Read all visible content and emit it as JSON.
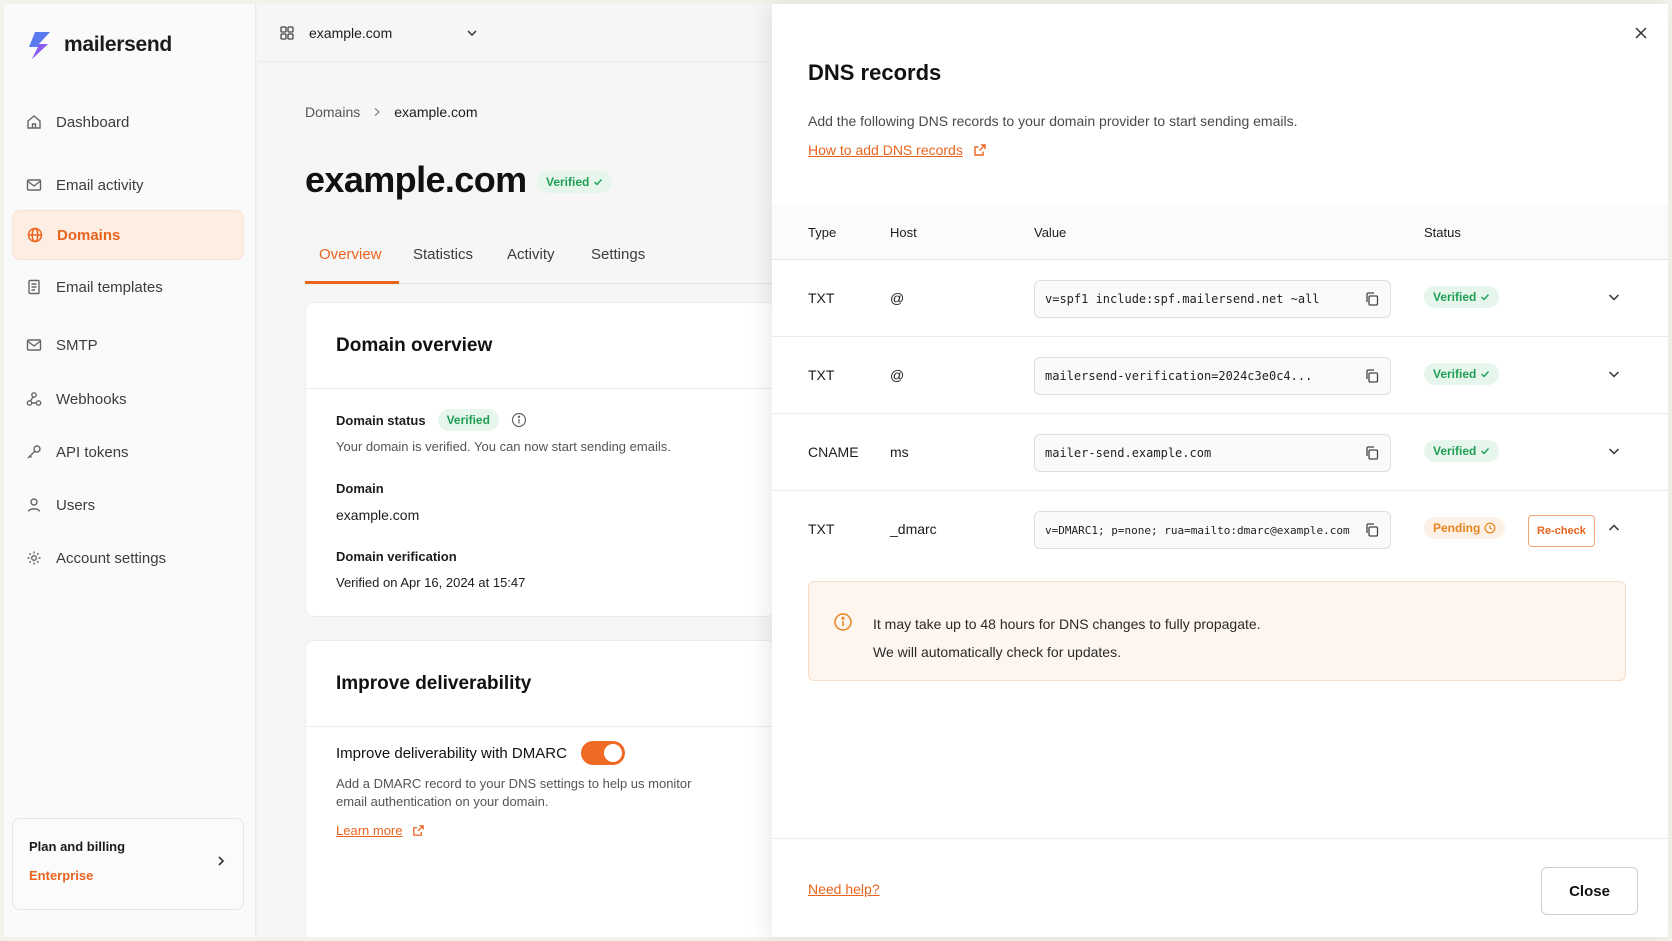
{
  "app": {
    "brand": "mailersend"
  },
  "sidebar": {
    "items": [
      {
        "label": "Dashboard",
        "icon": "home-icon"
      },
      {
        "label": "Email activity",
        "icon": "mail-icon"
      },
      {
        "label": "Domains",
        "icon": "globe-icon",
        "active": true
      },
      {
        "label": "Email templates",
        "icon": "document-icon"
      },
      {
        "label": "SMTP",
        "icon": "mail-icon"
      },
      {
        "label": "Webhooks",
        "icon": "webhook-icon"
      },
      {
        "label": "API tokens",
        "icon": "key-icon"
      },
      {
        "label": "Users",
        "icon": "user-icon"
      },
      {
        "label": "Account settings",
        "icon": "gear-icon"
      }
    ],
    "billing": {
      "title": "Plan and billing",
      "plan": "Enterprise"
    }
  },
  "topbar": {
    "domain_selector": "example.com"
  },
  "breadcrumb": {
    "parent": "Domains",
    "current": "example.com"
  },
  "page": {
    "title": "example.com",
    "status": "Verified"
  },
  "tabs": [
    "Overview",
    "Statistics",
    "Activity",
    "Settings"
  ],
  "overview": {
    "title": "Domain overview",
    "status_label": "Domain status",
    "status_value": "Verified",
    "status_text": "Your domain is verified. You can now start sending emails.",
    "domain_label": "Domain",
    "domain_value": "example.com",
    "verification_label": "Domain verification",
    "verification_value": "Verified on Apr 16, 2024 at 15:47"
  },
  "deliverability": {
    "title": "Improve deliverability",
    "dmarc_label": "Improve deliverability with DMARC",
    "dmarc_enabled": true,
    "description_line1": "Add a DMARC record to your DNS settings to help us monitor",
    "description_line2": "email authentication on your domain.",
    "learn_more": "Learn more"
  },
  "drawer": {
    "title": "DNS records",
    "description": "Add the following DNS records to your domain provider to start sending emails.",
    "howto_link": "How to add DNS records",
    "columns": {
      "type": "Type",
      "host": "Host",
      "value": "Value",
      "status": "Status"
    },
    "records": [
      {
        "type": "TXT",
        "host": "@",
        "value": "v=spf1 include:spf.mailersend.net ~all",
        "status": "Verified"
      },
      {
        "type": "TXT",
        "host": "@",
        "value": "mailersend-verification=2024c3e0c4...",
        "status": "Verified"
      },
      {
        "type": "CNAME",
        "host": "ms",
        "value": "mailer-send.example.com",
        "status": "Verified"
      },
      {
        "type": "TXT",
        "host": "_dmarc",
        "value": "v=DMARC1; p=none; rua=mailto:dmarc@example.com",
        "status": "Pending",
        "action": "Re-check"
      }
    ],
    "alert_line1": "It may take up to 48 hours for DNS changes to fully propagate.",
    "alert_line2": "We will automatically check for updates.",
    "need_help": "Need help?",
    "close": "Close"
  },
  "colors": {
    "accent": "#e8641f",
    "success": "#1f9e54",
    "pending": "#e8841f"
  }
}
